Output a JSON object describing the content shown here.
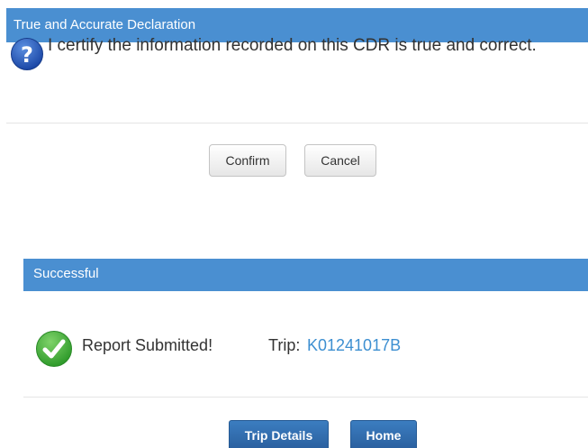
{
  "declaration_dialog": {
    "title": "True and Accurate Declaration",
    "icon": "question-icon",
    "message": "I certify the information recorded on this CDR is true and correct.",
    "confirm_label": "Confirm",
    "cancel_label": "Cancel"
  },
  "success_panel": {
    "title": "Successful",
    "icon": "checkmark-icon",
    "message": "Report Submitted!",
    "trip_label": "Trip:",
    "trip_id": "K01241017B",
    "trip_details_label": "Trip Details",
    "home_label": "Home"
  },
  "colors": {
    "header_blue": "#4a8fd1",
    "link_blue": "#3d8fd1",
    "primary_button": "#2f6aab",
    "success_green": "#3fae3c"
  }
}
